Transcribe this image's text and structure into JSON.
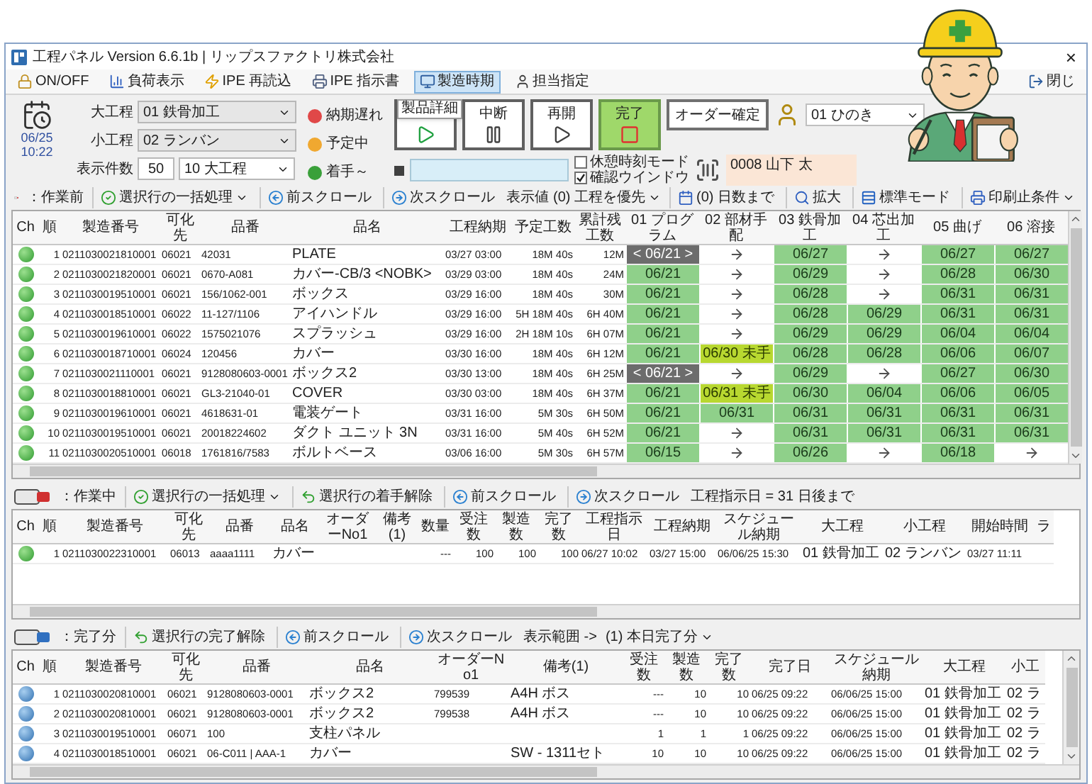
{
  "window": {
    "title": "工程パネル Version 6.6.1b | リップスファクトリ株式会社",
    "close": "×"
  },
  "toolbar": [
    {
      "label": "ON/OFF",
      "kind": "lock",
      "selected": false
    },
    {
      "label": "負荷表示",
      "kind": "chart",
      "selected": false
    },
    {
      "label": "IPE 再読込",
      "kind": "bolt",
      "selected": false
    },
    {
      "label": "IPE 指示書",
      "kind": "print",
      "selected": false
    },
    {
      "label": "製造時期",
      "kind": "monitor",
      "selected": true
    },
    {
      "label": "担当指定",
      "kind": "user",
      "selected": false
    },
    {
      "label": "閉じ",
      "kind": "exit",
      "selected": false
    }
  ],
  "panel": {
    "date": "06/25",
    "time": "10:22",
    "filters": [
      {
        "label": "大工程",
        "value": "01 鉄骨加工"
      },
      {
        "label": "小工程",
        "value": "02 ランバン"
      }
    ],
    "count": {
      "label": "表示件数",
      "value": "50",
      "select": "10 大工程"
    },
    "legend": [
      {
        "label": "納期遅れ",
        "color": "#e04848"
      },
      {
        "label": "予定中",
        "color": "#f0a830"
      },
      {
        "label": "着手～",
        "color": "#3aa03a"
      }
    ],
    "actions": [
      {
        "tooltip": "製品詳細",
        "kind": "start",
        "selected": false
      },
      {
        "label": "中断",
        "kind": "pause",
        "selected": false
      },
      {
        "label": "再開",
        "kind": "resume",
        "selected": false
      },
      {
        "label": "完了",
        "kind": "stop",
        "selected": true
      }
    ],
    "confirm": "オーダー確定",
    "operator": {
      "group": "01 ひのき",
      "name": "0008 山下 太"
    },
    "options": [
      {
        "label": "休憩時刻モード",
        "checked": false
      },
      {
        "label": "確認ウインドウ",
        "checked": true
      }
    ]
  },
  "waiting": {
    "completed": false,
    "toolbar": [
      {
        "text": "：作業前",
        "kind": "label",
        "dropdown": false
      },
      {
        "text": "選択行の一括処理",
        "kind": "check",
        "dropdown": true
      },
      {
        "text": "前スクロール",
        "kind": "left",
        "dropdown": false
      },
      {
        "text": "次スクロール",
        "kind": "right",
        "dropdown": false
      },
      {
        "text": "表示値 (0) 工程を優先",
        "kind": "label",
        "dropdown": true
      },
      {
        "text": "(0) 日数まで",
        "kind": "calendar",
        "dropdown": false
      },
      {
        "text": "拡大",
        "kind": "search",
        "dropdown": false
      },
      {
        "text": "標準モード",
        "kind": "mode",
        "dropdown": false
      },
      {
        "text": "印刷止条件",
        "kind": "print",
        "dropdown": true
      }
    ],
    "columns": [
      "Ch",
      "順",
      "製造番号",
      "可化先",
      "品番",
      "品名",
      "工程納期",
      "予定工数",
      "累計残工数",
      "01 プログラム",
      "02 部材手配",
      "03 鉄骨加工",
      "04 芯出加工",
      "05 曲げ",
      "06 溶接"
    ],
    "rows": [
      {
        "no": "1",
        "serial": "0211030021810001",
        "dest": "06021",
        "part": "42031",
        "name": "PLATE",
        "due": "03/27 03:00",
        "plan": "18M 40s",
        "remain": "12M",
        "steps": [
          {
            "text": "< 06/21 >",
            "kind": "current"
          },
          {
            "kind": "pending"
          },
          {
            "text": "06/27",
            "kind": "done"
          },
          {
            "kind": "pending"
          },
          {
            "text": "06/27",
            "kind": "done"
          },
          {
            "text": "06/27",
            "kind": "done"
          }
        ]
      },
      {
        "no": "2",
        "serial": "0211030021820001",
        "dest": "06021",
        "part": "0670-A081",
        "name": "カバー-CB/3 <NOBK>",
        "due": "03/29 03:00",
        "plan": "18M 40s",
        "remain": "24M",
        "steps": [
          {
            "text": "06/21",
            "kind": "done"
          },
          {
            "kind": "pending"
          },
          {
            "text": "06/29",
            "kind": "done"
          },
          {
            "kind": "pending"
          },
          {
            "text": "06/28",
            "kind": "done"
          },
          {
            "text": "06/30",
            "kind": "done"
          }
        ]
      },
      {
        "no": "3",
        "serial": "0211030019510001",
        "dest": "06021",
        "part": "156/1062-001",
        "name": "ボックス",
        "due": "03/29 16:00",
        "plan": "18M 40s",
        "remain": "30M",
        "steps": [
          {
            "text": "06/21",
            "kind": "done"
          },
          {
            "kind": "pending"
          },
          {
            "text": "06/28",
            "kind": "done"
          },
          {
            "kind": "pending"
          },
          {
            "text": "06/31",
            "kind": "done"
          },
          {
            "text": "06/31",
            "kind": "done"
          }
        ]
      },
      {
        "no": "4",
        "serial": "0211030018510001",
        "dest": "06022",
        "part": "11-127/1106",
        "name": "アイハンドル",
        "due": "03/29 16:00",
        "plan": "5H 18M 40s",
        "remain": "6H 40M",
        "steps": [
          {
            "text": "06/21",
            "kind": "done"
          },
          {
            "kind": "pending"
          },
          {
            "text": "06/28",
            "kind": "done"
          },
          {
            "text": "06/29",
            "kind": "done"
          },
          {
            "text": "06/31",
            "kind": "done"
          },
          {
            "text": "06/31",
            "kind": "done"
          }
        ]
      },
      {
        "no": "5",
        "serial": "0211030019610001",
        "dest": "06022",
        "part": "1575021076",
        "name": "スプラッシュ",
        "due": "03/29 16:00",
        "plan": "2H 18M 10s",
        "remain": "6H 07M",
        "steps": [
          {
            "text": "06/21",
            "kind": "done"
          },
          {
            "kind": "pending"
          },
          {
            "text": "06/29",
            "kind": "done"
          },
          {
            "text": "06/29",
            "kind": "done"
          },
          {
            "text": "06/04",
            "kind": "done"
          },
          {
            "text": "06/04",
            "kind": "done"
          }
        ]
      },
      {
        "no": "6",
        "serial": "0211030018710001",
        "dest": "06024",
        "part": "120456",
        "name": "カバー",
        "due": "03/30 16:00",
        "plan": "18M 40s",
        "remain": "6H 12M",
        "steps": [
          {
            "text": "06/21",
            "kind": "done"
          },
          {
            "text": "06/30 未手",
            "kind": "warn"
          },
          {
            "text": "06/28",
            "kind": "done"
          },
          {
            "text": "06/28",
            "kind": "done"
          },
          {
            "text": "06/06",
            "kind": "done"
          },
          {
            "text": "06/07",
            "kind": "done"
          }
        ]
      },
      {
        "no": "7",
        "serial": "0211030021110001",
        "dest": "06021",
        "part": "9128080603-0001",
        "name": "ボックス2",
        "due": "03/30 13:00",
        "plan": "18M 40s",
        "remain": "6H 25M",
        "steps": [
          {
            "text": "< 06/21 >",
            "kind": "current"
          },
          {
            "kind": "pending"
          },
          {
            "text": "06/29",
            "kind": "done"
          },
          {
            "kind": "pending"
          },
          {
            "text": "06/27",
            "kind": "done"
          },
          {
            "text": "06/30",
            "kind": "done"
          }
        ]
      },
      {
        "no": "8",
        "serial": "0211030018810001",
        "dest": "06021",
        "part": "GL3-21040-01",
        "name": "COVER",
        "due": "03/30 03:00",
        "plan": "18M 40s",
        "remain": "6H 37M",
        "steps": [
          {
            "text": "06/21",
            "kind": "done"
          },
          {
            "text": "06/31 未手",
            "kind": "warn"
          },
          {
            "text": "06/30",
            "kind": "done"
          },
          {
            "text": "06/04",
            "kind": "done"
          },
          {
            "text": "06/06",
            "kind": "done"
          },
          {
            "text": "06/05",
            "kind": "done"
          }
        ]
      },
      {
        "no": "9",
        "serial": "0211030019610001",
        "dest": "06021",
        "part": "4618631-01",
        "name": "電装ゲート",
        "due": "03/31 16:00",
        "plan": "5M 30s",
        "remain": "6H 50M",
        "steps": [
          {
            "text": "06/21",
            "kind": "done"
          },
          {
            "text": "06/31",
            "kind": "done"
          },
          {
            "text": "06/31",
            "kind": "done"
          },
          {
            "text": "06/31",
            "kind": "done"
          },
          {
            "text": "06/31",
            "kind": "done"
          },
          {
            "text": "06/31",
            "kind": "done"
          }
        ]
      },
      {
        "no": "10",
        "serial": "0211030019510001",
        "dest": "06021",
        "part": "20018224602",
        "name": "ダクト ユニット 3N",
        "due": "03/31 16:00",
        "plan": "5M 40s",
        "remain": "6H 52M",
        "steps": [
          {
            "text": "06/21",
            "kind": "done"
          },
          {
            "kind": "pending"
          },
          {
            "text": "06/31",
            "kind": "done"
          },
          {
            "text": "06/31",
            "kind": "done"
          },
          {
            "text": "06/31",
            "kind": "done"
          },
          {
            "text": "06/31",
            "kind": "done"
          }
        ]
      },
      {
        "no": "11",
        "serial": "0211030020510001",
        "dest": "06018",
        "part": "1761816/7583",
        "name": "ボルトベース",
        "due": "03/06 16:00",
        "plan": "5M 30s",
        "remain": "6H 57M",
        "steps": [
          {
            "text": "06/15",
            "kind": "done"
          },
          {
            "kind": "pending"
          },
          {
            "text": "06/26",
            "kind": "done"
          },
          {
            "kind": "pending"
          },
          {
            "text": "06/18",
            "kind": "done"
          },
          {
            "kind": "pending"
          }
        ]
      }
    ]
  },
  "working": {
    "completed": false,
    "toolbar": [
      {
        "text": "：作業中",
        "kind": "label",
        "dropdown": false
      },
      {
        "text": "選択行の一括処理",
        "kind": "check",
        "dropdown": true
      },
      {
        "text": "選択行の着手解除",
        "kind": "undo",
        "dropdown": false
      },
      {
        "text": "前スクロール",
        "kind": "left",
        "dropdown": false
      },
      {
        "text": "次スクロール",
        "kind": "right",
        "dropdown": false
      },
      {
        "text": "工程指示日 = 31 日後まで",
        "kind": "label",
        "dropdown": false
      }
    ],
    "columns": [
      "Ch",
      "順",
      "製造番号",
      "可化先",
      "品番",
      "品名",
      "オーダーNo1",
      "備考(1)",
      "数量",
      "受注数",
      "製造数",
      "完了数",
      "工程指示日",
      "工程納期",
      "スケジュール納期",
      "大工程",
      "小工程",
      "開始時間",
      "ラ"
    ],
    "rows": [
      {
        "no": "1",
        "serial": "0211030022310001",
        "dest": "06013",
        "part": "aaaa1111",
        "name": "カバー",
        "qty": "---",
        "ordered": "100",
        "made": "100",
        "done": "100",
        "instructed": "06/27 10:02",
        "due": "03/27 15:00",
        "schedule": "06/06/25 15:30",
        "major": "01 鉄骨加工",
        "minor": "02 ランバン",
        "start": "03/27 11:11"
      }
    ]
  },
  "finished": {
    "completed": true,
    "toolbar": [
      {
        "text": "：完了分",
        "kind": "label",
        "dropdown": false
      },
      {
        "text": "選択行の完了解除",
        "kind": "undo",
        "dropdown": false
      },
      {
        "text": "前スクロール",
        "kind": "left",
        "dropdown": false
      },
      {
        "text": "次スクロール",
        "kind": "right",
        "dropdown": false
      },
      {
        "text": "表示範囲 ->",
        "kind": "label",
        "dropdown": false
      },
      {
        "text": "(1) 本日完了分",
        "kind": "label",
        "dropdown": true
      }
    ],
    "columns": [
      "Ch",
      "順",
      "製造番号",
      "可化先",
      "品番",
      "品名",
      "オーダーNo1",
      "備考(1)",
      "受注数",
      "製造数",
      "完了数",
      "完了日",
      "スケジュール納期",
      "大工程",
      "小工"
    ],
    "rows": [
      {
        "no": "1",
        "serial": "0211030020810001",
        "dest": "06021",
        "part": "9128080603-0001",
        "name": "ボックス2",
        "order": "799539",
        "note": "A4H ボス",
        "ordered": "---",
        "made": "10",
        "done": "10",
        "finished": "06/25 09:22",
        "schedule": "06/06/25 15:00",
        "major": "01 鉄骨加工",
        "minor": "02 ラ"
      },
      {
        "no": "2",
        "serial": "0211030020810001",
        "dest": "06021",
        "part": "9128080603-0001",
        "name": "ボックス2",
        "order": "799538",
        "note": "A4H ボス",
        "ordered": "---",
        "made": "10",
        "done": "10",
        "finished": "06/25 09:22",
        "schedule": "06/06/25 15:00",
        "major": "01 鉄骨加工",
        "minor": "02 ラ"
      },
      {
        "no": "3",
        "serial": "0211030019510001",
        "dest": "06071",
        "part": "100",
        "name": "支柱パネル",
        "ordered": "1",
        "made": "1",
        "done": "1",
        "finished": "06/25 09:22",
        "schedule": "06/06/25 15:00",
        "major": "01 鉄骨加工",
        "minor": "02 ラ"
      },
      {
        "no": "4",
        "serial": "0211030018510001",
        "dest": "06021",
        "part": "06-C011 | AAA-1",
        "name": "カバー",
        "note": "SW - 1311セト",
        "ordered": "10",
        "made": "10",
        "done": "10",
        "finished": "06/25 09:22",
        "schedule": "06/06/25 15:00",
        "major": "01 鉄骨加工",
        "minor": "02 ラ"
      }
    ]
  }
}
